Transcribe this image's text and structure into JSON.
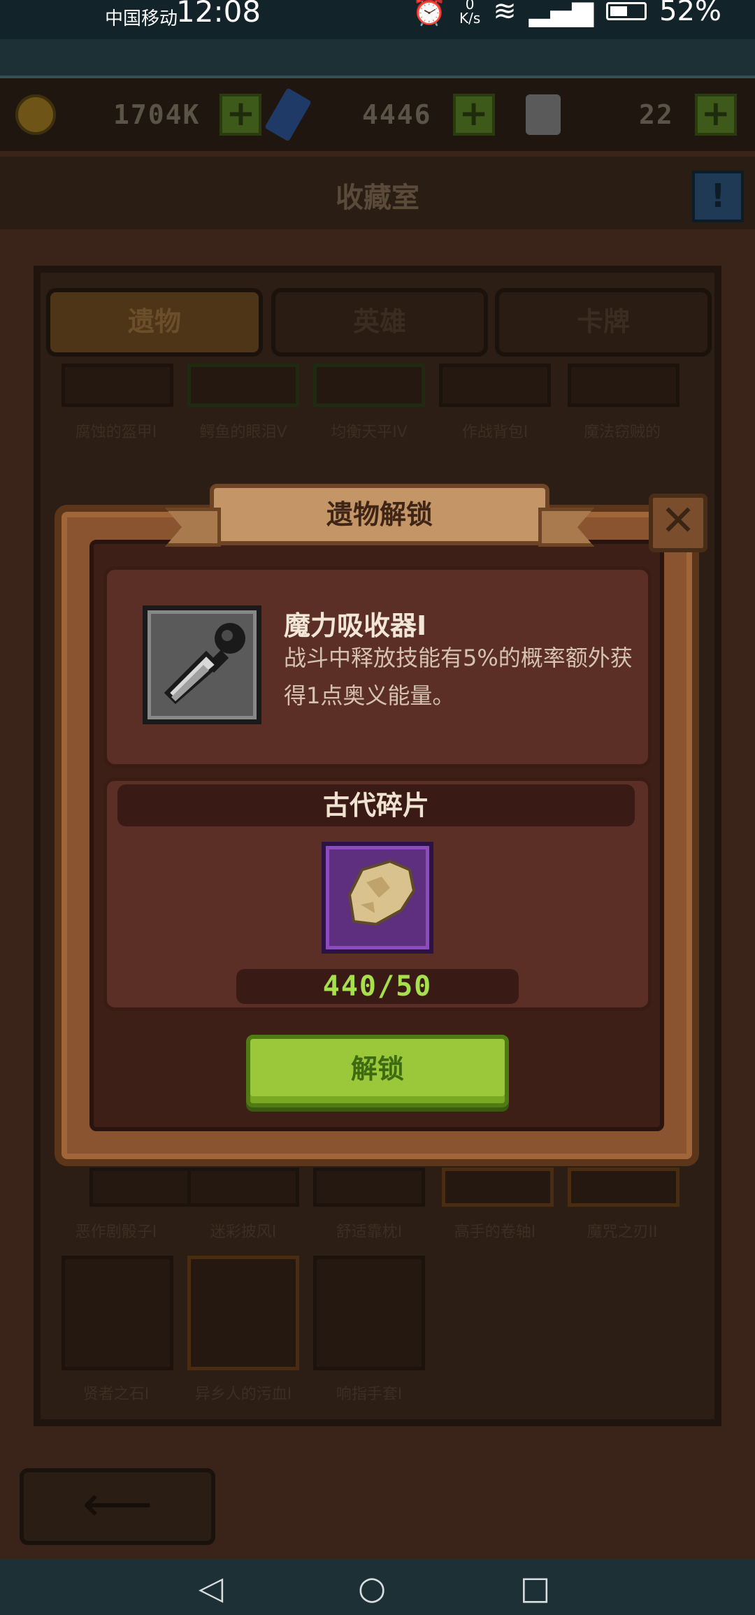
{
  "status_bar": {
    "carrier": "中国移动",
    "time": "12:08",
    "net_speed_unit": "K/s",
    "battery": "52%"
  },
  "currency": {
    "gold": "1704K",
    "gems": "4446",
    "bags": "22"
  },
  "header": {
    "title": "收藏室"
  },
  "tabs": [
    {
      "label": "遗物",
      "active": true
    },
    {
      "label": "英雄",
      "active": false
    },
    {
      "label": "卡牌",
      "active": false
    }
  ],
  "grid": {
    "row1_labels": [
      "腐蚀的盔甲I",
      "鳄鱼的眼泪V",
      "均衡天平IV",
      "作战背包I",
      "魔法窃贼的"
    ],
    "row5_labels": [
      "恶作剧骰子I",
      "迷彩披风I",
      "舒适靠枕I",
      "高手的卷轴I",
      "魔咒之刃II"
    ],
    "row6_labels": [
      "贤者之石I",
      "异乡人的污血I",
      "响指手套I"
    ]
  },
  "modal": {
    "title": "遗物解锁",
    "relic": {
      "name": "魔力吸收器I",
      "description": "战斗中释放技能有5%的概率额外获得1点奥义能量。",
      "icon": "syringe-icon"
    },
    "material": {
      "name": "古代碎片",
      "icon": "ancient-fragment-icon",
      "have": 440,
      "need": 50,
      "count_text": "440/50"
    },
    "unlock_label": "解锁"
  },
  "colors": {
    "accent_green": "#9ac83a",
    "count_green": "#a6e04c",
    "modal_frame": "#8a5430",
    "rarity_purple": "#5d2f7e"
  }
}
